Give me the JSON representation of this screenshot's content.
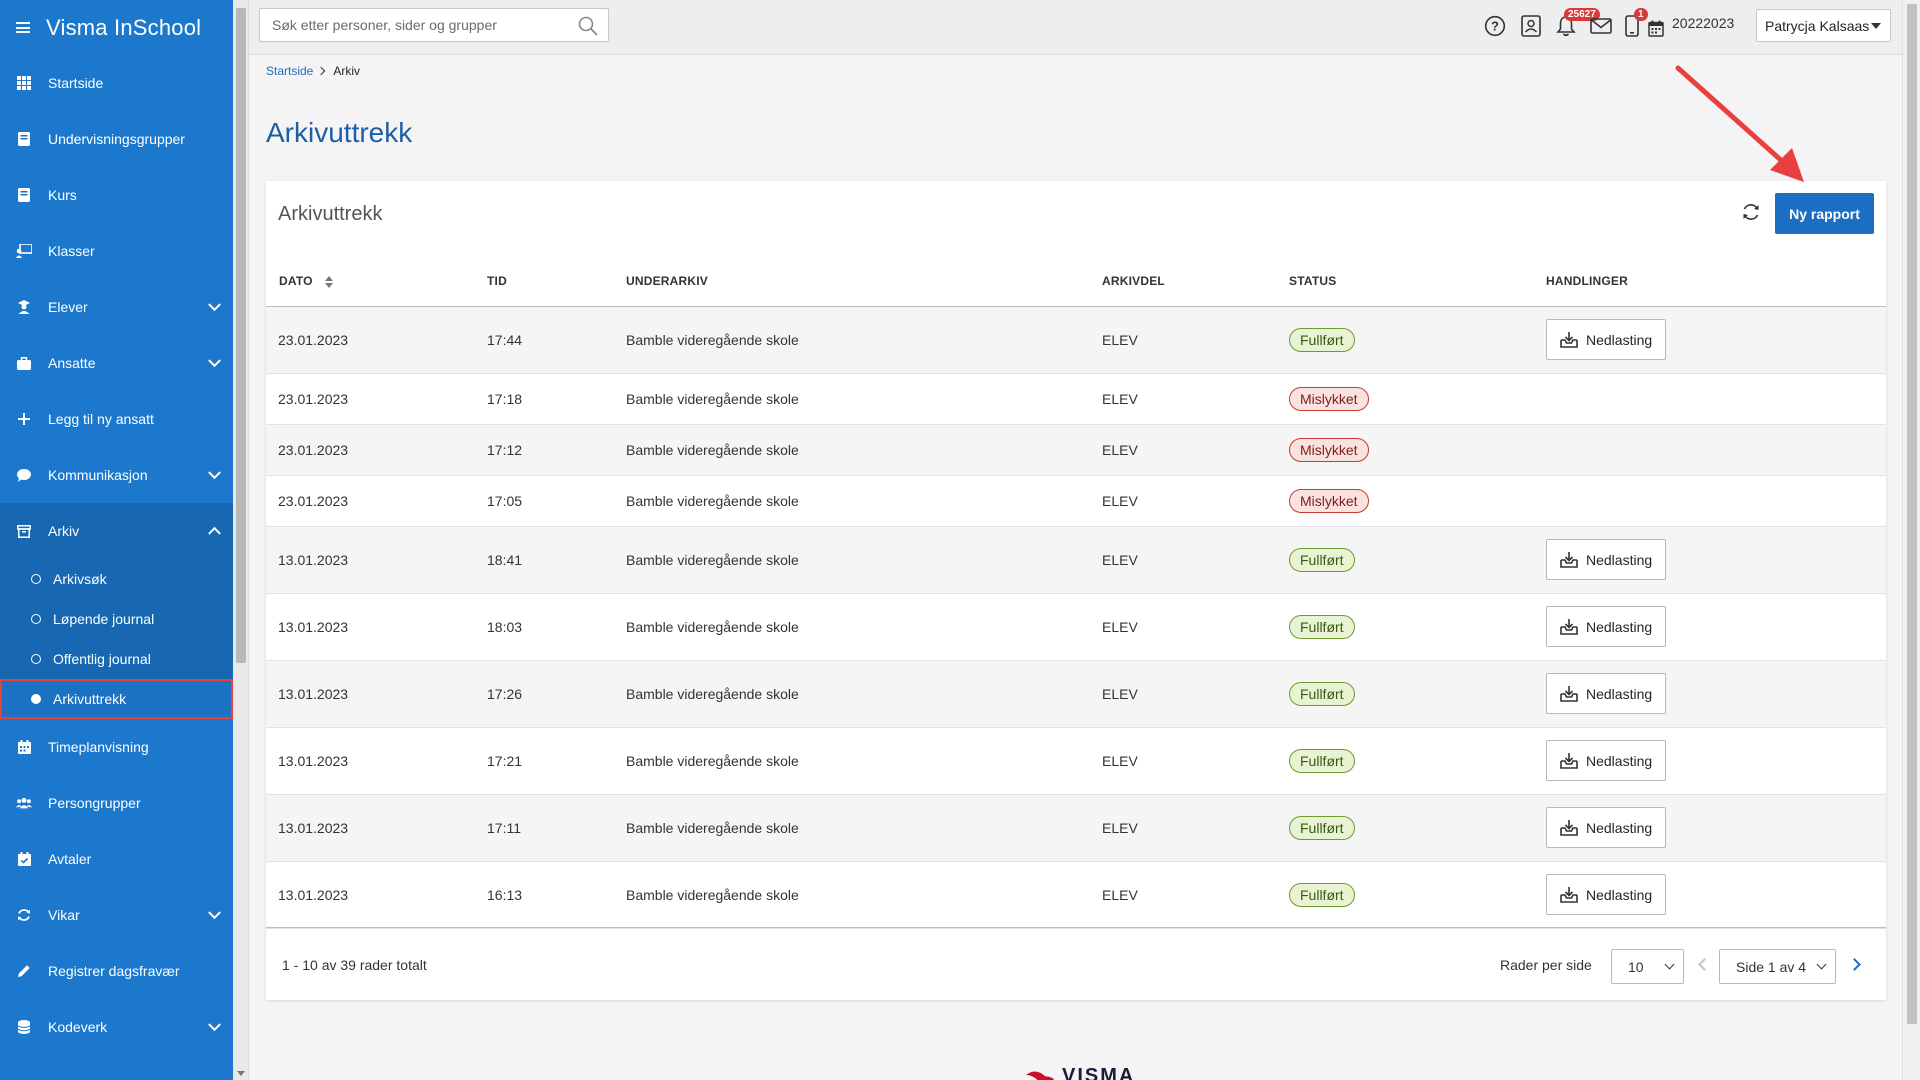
{
  "app": {
    "title": "Visma InSchool"
  },
  "sidebar": {
    "items": [
      {
        "label": "Startside",
        "icon": "grid-icon"
      },
      {
        "label": "Undervisningsgrupper",
        "icon": "book-icon"
      },
      {
        "label": "Kurs",
        "icon": "book-icon"
      },
      {
        "label": "Klasser",
        "icon": "teacher-icon"
      },
      {
        "label": "Elever",
        "icon": "student-icon"
      },
      {
        "label": "Ansatte",
        "icon": "briefcase-icon"
      },
      {
        "label": "Legg til ny ansatt",
        "icon": "plus-icon"
      },
      {
        "label": "Kommunikasjon",
        "icon": "chat-icon"
      },
      {
        "label": "Arkiv",
        "icon": "archive-icon"
      },
      {
        "label": "Timeplanvisning",
        "icon": "calendar-icon"
      },
      {
        "label": "Persongrupper",
        "icon": "people-icon"
      },
      {
        "label": "Avtaler",
        "icon": "calendar-check-icon"
      },
      {
        "label": "Vikar",
        "icon": "refresh-icon"
      },
      {
        "label": "Registrer dagsfravær",
        "icon": "pencil-icon"
      },
      {
        "label": "Kodeverk",
        "icon": "database-icon"
      }
    ],
    "arkiv_sub": [
      {
        "label": "Arkivsøk"
      },
      {
        "label": "Løpende journal"
      },
      {
        "label": "Offentlig journal"
      },
      {
        "label": "Arkivuttrekk"
      }
    ]
  },
  "header": {
    "search_placeholder": "Søk etter personer, sider og grupper",
    "notification_count": "25627",
    "device_count": "1",
    "year": "20222023",
    "user": "Patrycja Kalsaas"
  },
  "breadcrumb": {
    "home": "Startside",
    "current": "Arkiv"
  },
  "page_title": "Arkivuttrekk",
  "card": {
    "title": "Arkivuttrekk",
    "new_report_label": "Ny rapport",
    "columns": [
      "DATO",
      "TID",
      "UNDERARKIV",
      "ARKIVDEL",
      "STATUS",
      "HANDLINGER"
    ],
    "download_label": "Nedlasting",
    "rows": [
      {
        "date": "23.01.2023",
        "time": "17:44",
        "sub": "Bamble videregående skole",
        "part": "ELEV",
        "status": "Fullført",
        "ok": true
      },
      {
        "date": "23.01.2023",
        "time": "17:18",
        "sub": "Bamble videregående skole",
        "part": "ELEV",
        "status": "Mislykket",
        "ok": false
      },
      {
        "date": "23.01.2023",
        "time": "17:12",
        "sub": "Bamble videregående skole",
        "part": "ELEV",
        "status": "Mislykket",
        "ok": false
      },
      {
        "date": "23.01.2023",
        "time": "17:05",
        "sub": "Bamble videregående skole",
        "part": "ELEV",
        "status": "Mislykket",
        "ok": false
      },
      {
        "date": "13.01.2023",
        "time": "18:41",
        "sub": "Bamble videregående skole",
        "part": "ELEV",
        "status": "Fullført",
        "ok": true
      },
      {
        "date": "13.01.2023",
        "time": "18:03",
        "sub": "Bamble videregående skole",
        "part": "ELEV",
        "status": "Fullført",
        "ok": true
      },
      {
        "date": "13.01.2023",
        "time": "17:26",
        "sub": "Bamble videregående skole",
        "part": "ELEV",
        "status": "Fullført",
        "ok": true
      },
      {
        "date": "13.01.2023",
        "time": "17:21",
        "sub": "Bamble videregående skole",
        "part": "ELEV",
        "status": "Fullført",
        "ok": true
      },
      {
        "date": "13.01.2023",
        "time": "17:11",
        "sub": "Bamble videregående skole",
        "part": "ELEV",
        "status": "Fullført",
        "ok": true
      },
      {
        "date": "13.01.2023",
        "time": "16:13",
        "sub": "Bamble videregående skole",
        "part": "ELEV",
        "status": "Fullført",
        "ok": true
      }
    ],
    "footer": {
      "total": "1 - 10 av 39 rader totalt",
      "rows_per_page_label": "Rader per side",
      "rows_per_page": "10",
      "page": "Side 1 av 4"
    }
  },
  "footer_logo": "VISMA",
  "colors": {
    "sidebar": "#1b78cc",
    "accent": "#1b6ec2",
    "success": "#6d9b2e",
    "danger": "#c53a32",
    "annotation": "#e8403f"
  }
}
